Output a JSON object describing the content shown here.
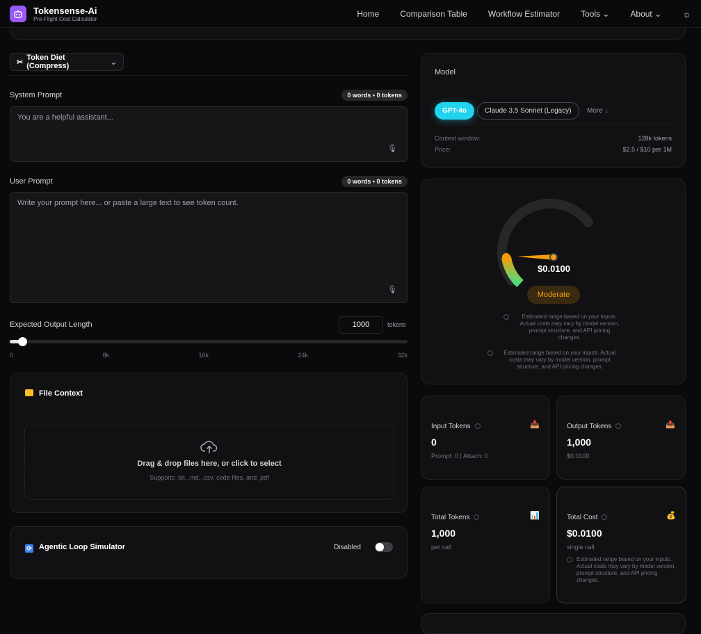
{
  "nav": {
    "title": "Tokensense-Ai",
    "subtitle": "Pre-Flight Cost Calculator",
    "links": [
      "Home",
      "Comparison Table",
      "Workflow Estimator",
      "Tools",
      "About"
    ]
  },
  "toolbar": {
    "token_diet": "Token Diet (Compress)"
  },
  "system_prompt": {
    "label": "System Prompt",
    "badge": "0 words • 0 tokens",
    "placeholder": "You are a helpful assistant..."
  },
  "user_prompt": {
    "label": "User Prompt",
    "badge": "0 words • 0 tokens",
    "placeholder": "Write your prompt here... or paste a large text to see token count."
  },
  "output_length": {
    "label": "Expected Output Length",
    "value": "1000",
    "unit": "tokens",
    "slider_fraction": 0.03125,
    "ticks": [
      "0",
      "8k",
      "16k",
      "24k",
      "32k"
    ]
  },
  "file_context": {
    "title": "File Context",
    "drop": "Drag & drop files here, or click to select",
    "supports": "Supports .txt, .md, .csv, code files, and .pdf"
  },
  "agentic": {
    "title": "Agentic Loop Simulator",
    "status": "Disabled",
    "enabled": false
  },
  "model": {
    "label": "Model",
    "options": [
      "GPT-4o",
      "Claude 3.5 Sonnet (Legacy)"
    ],
    "selected": "GPT-4o",
    "more": "More ↓",
    "context_label": "Context window:",
    "context_value": "128k tokens",
    "price_label": "Price:",
    "price_value": "$2.5 / $10 per 1M",
    "accent": "#22d3ee"
  },
  "gauge": {
    "value": "$0.0100",
    "level": "Moderate",
    "note1": "Estimated range based on your inputs. Actual costs may vary by model version, prompt structure, and API pricing changes.",
    "note2": "Estimated range based on your inputs. Actual costs may vary by model version, prompt structure, and API pricing changes."
  },
  "stats": {
    "input": {
      "label": "Input Tokens",
      "value": "0",
      "sub": "Prompt: 0 | Attach: 0",
      "icon": "inbox-tray-icon"
    },
    "output": {
      "label": "Output Tokens",
      "value": "1,000",
      "sub": "$0.0100",
      "icon": "outbox-tray-icon"
    },
    "total": {
      "label": "Total Tokens",
      "value": "1,000",
      "sub": "per call",
      "icon": "bar-chart-icon"
    },
    "cost": {
      "label": "Total Cost",
      "value": "$0.0100",
      "sub": "single call",
      "note": "Estimated range based on your inputs. Actual costs may vary by model version, prompt structure, and API pricing changes.",
      "icon": "money-bag-icon"
    }
  }
}
